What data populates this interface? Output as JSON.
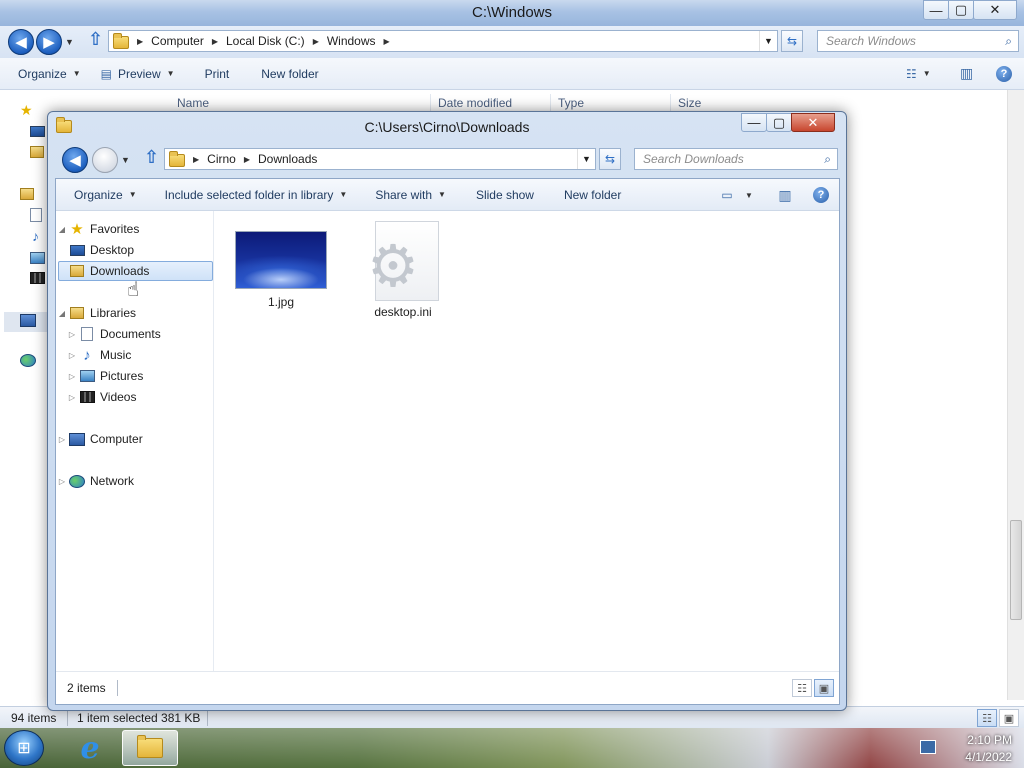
{
  "background_window": {
    "title": "C:\\Windows",
    "caption_buttons": {
      "minimize": "—",
      "maximize": "▢",
      "close": "✕"
    },
    "address": [
      "Computer",
      "Local Disk (C:)",
      "Windows"
    ],
    "search_placeholder": "Search Windows",
    "toolbar": {
      "organize": "Organize",
      "preview": "Preview",
      "print": "Print",
      "new_folder": "New folder"
    },
    "columns": {
      "name": "Name",
      "date_modified": "Date modified",
      "type": "Type",
      "size": "Size"
    },
    "status": {
      "count": "94 items",
      "selection": "1 item selected  381 KB"
    }
  },
  "window": {
    "title": "C:\\Users\\Cirno\\Downloads",
    "caption_buttons": {
      "minimize": "—",
      "maximize": "▢",
      "close": "✕"
    },
    "address": [
      "Cirno",
      "Downloads"
    ],
    "search_placeholder": "Search Downloads",
    "toolbar": {
      "organize": "Organize",
      "include_library": "Include selected folder in library",
      "share_with": "Share with",
      "slide_show": "Slide show",
      "new_folder": "New folder"
    },
    "nav": {
      "favorites": "Favorites",
      "desktop": "Desktop",
      "downloads": "Downloads",
      "libraries": "Libraries",
      "documents": "Documents",
      "music": "Music",
      "pictures": "Pictures",
      "videos": "Videos",
      "computer": "Computer",
      "network": "Network"
    },
    "files": [
      {
        "name": "1.jpg",
        "icon": "image-thumbnail"
      },
      {
        "name": "desktop.ini",
        "icon": "settings-file-icon"
      }
    ],
    "status": {
      "count": "2 items"
    }
  },
  "taskbar": {
    "time": "2:10 PM",
    "date": "4/1/2022"
  },
  "colors": {
    "accent": "#2f6fc5",
    "selection": "#cfe2f8",
    "selection_border": "#84acdd"
  }
}
